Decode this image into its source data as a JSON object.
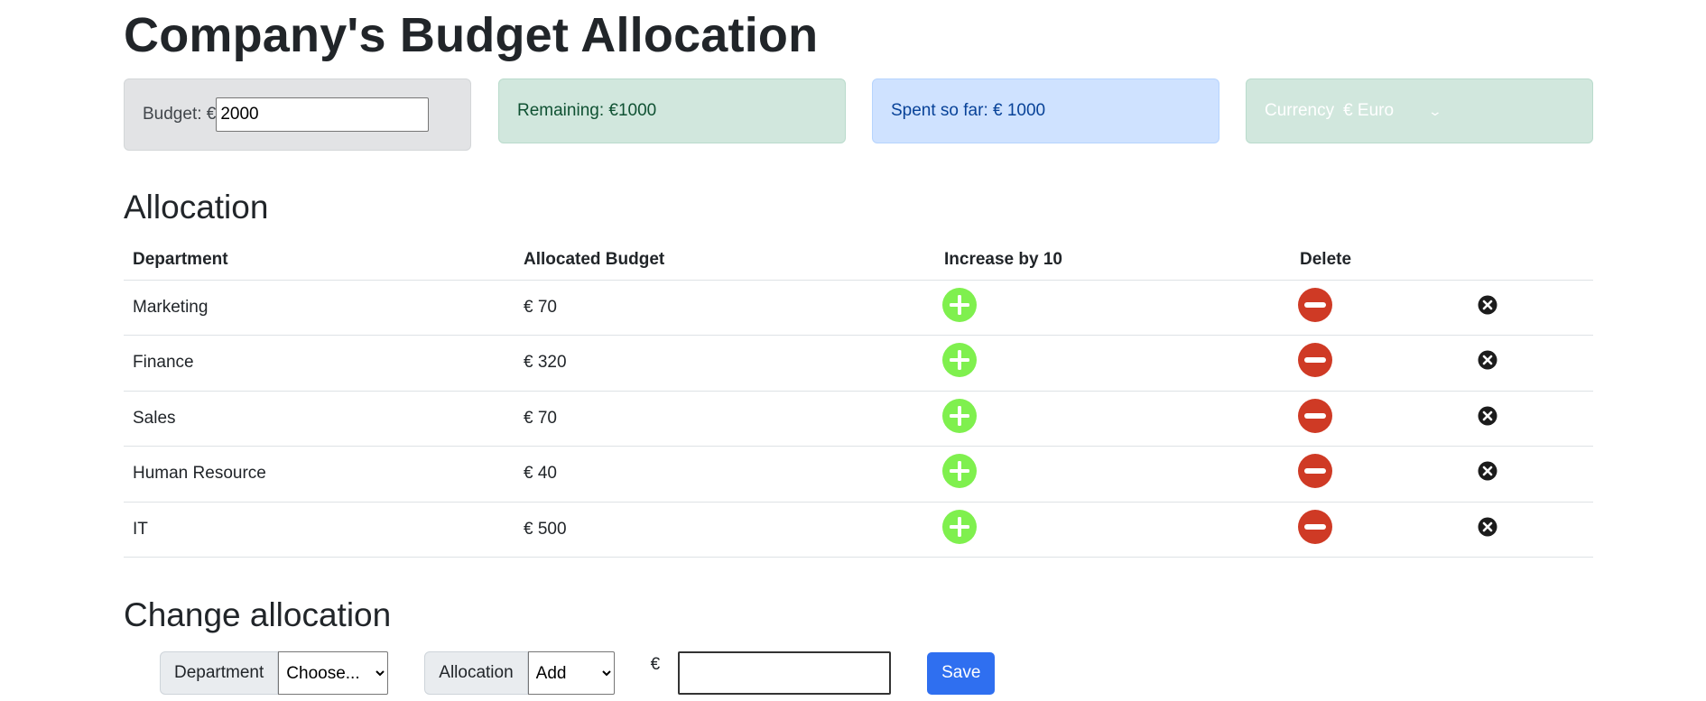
{
  "header": {
    "title": "Company's Budget Allocation"
  },
  "stats": {
    "budget_label": "Budget: €",
    "budget_value": "2000",
    "remaining": "Remaining: €1000",
    "spent": "Spent so far: € 1000",
    "currency_label": "Currency",
    "currency_value": "€ Euro"
  },
  "allocation": {
    "heading": "Allocation",
    "columns": [
      "Department",
      "Allocated Budget",
      "Increase by 10",
      "Delete"
    ],
    "rows": [
      {
        "department": "Marketing",
        "budget": "€ 70"
      },
      {
        "department": "Finance",
        "budget": "€ 320"
      },
      {
        "department": "Sales",
        "budget": "€ 70"
      },
      {
        "department": "Human Resource",
        "budget": "€ 40"
      },
      {
        "department": "IT",
        "budget": "€ 500"
      }
    ]
  },
  "change": {
    "heading": "Change allocation",
    "department_label": "Department",
    "department_selected": "Choose...",
    "allocation_label": "Allocation",
    "allocation_selected": "Add",
    "currency_symbol": "€",
    "amount_value": "",
    "save_label": "Save"
  },
  "colors": {
    "increase": "#7ff04e",
    "decrease": "#cf3a25",
    "delete": "#1c1c1c"
  }
}
